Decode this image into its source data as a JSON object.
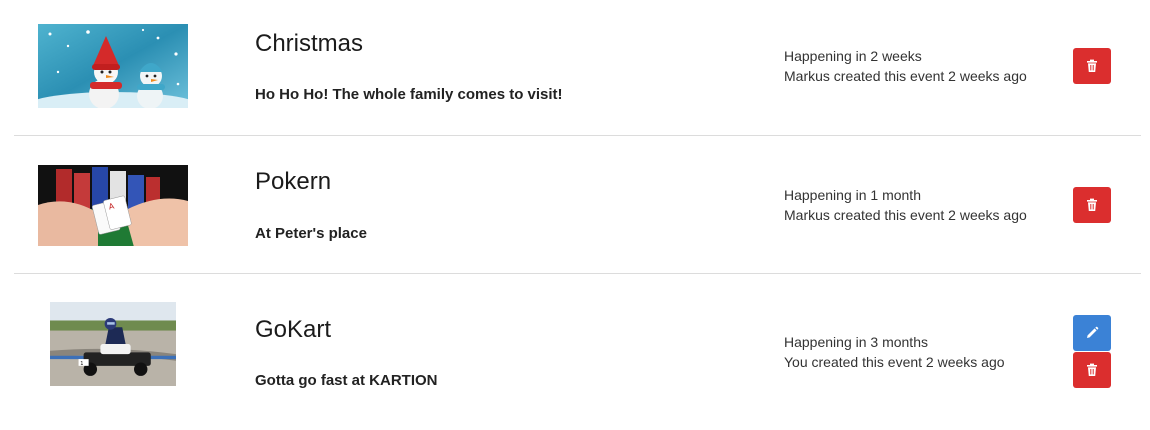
{
  "events": [
    {
      "title": "Christmas",
      "description": "Ho Ho Ho! The whole family comes to visit!",
      "happening": "Happening in 2 weeks",
      "created": "Markus created this event 2 weeks ago",
      "image": "snowmen-photo",
      "actions": [
        "delete"
      ]
    },
    {
      "title": "Pokern",
      "description": "At Peter's place",
      "happening": "Happening in 1 month",
      "created": "Markus created this event 2 weeks ago",
      "image": "poker-photo",
      "actions": [
        "delete"
      ]
    },
    {
      "title": "GoKart",
      "description": "Gotta go fast at KARTION",
      "happening": "Happening in 3 months",
      "created": "You created this event 2 weeks ago",
      "image": "gokart-photo",
      "actions": [
        "edit",
        "delete"
      ]
    }
  ],
  "icons": {
    "delete": "trash-icon",
    "edit": "pencil-icon"
  },
  "colors": {
    "delete_button": "#db2e2e",
    "edit_button": "#3b82d6",
    "divider": "#dcdcdc"
  }
}
